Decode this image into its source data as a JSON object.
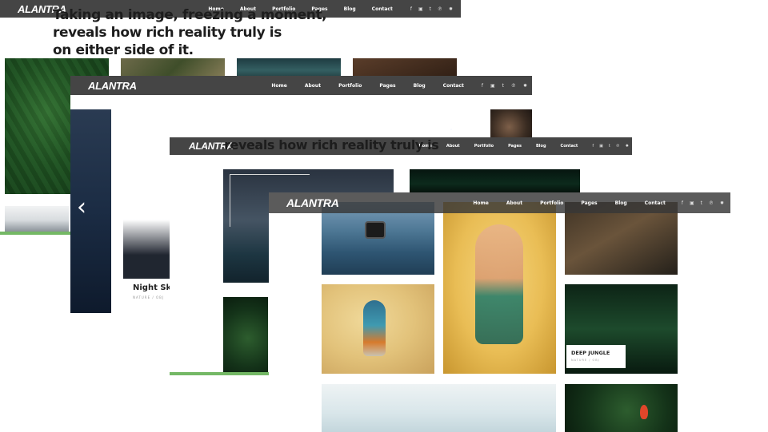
{
  "brand": {
    "logo": "ALANTRA"
  },
  "nav": {
    "items": [
      "Home",
      "About",
      "Portfolio",
      "Pages",
      "Blog",
      "Contact"
    ],
    "social": [
      "f",
      "▣",
      "t",
      "℗",
      "✹"
    ]
  },
  "social_icons": [
    "facebook-icon",
    "instagram-icon",
    "twitter-icon",
    "pinterest-icon",
    "dribbble-icon"
  ],
  "headline": {
    "line1": "Taking an image, freezing a moment,",
    "line2": "reveals how rich reality truly is",
    "line3": "on either side of it."
  },
  "slider": {
    "prev_arrow": "‹",
    "caption_title": "Night Sky",
    "caption_sub": "NATURE / OBJ"
  },
  "gallery": {
    "caption_title": "DEEP JUNGLE",
    "caption_sub": "NATURE / OBJ"
  },
  "colors": {
    "navbar": "#454545",
    "accent_green": "#74b865"
  }
}
